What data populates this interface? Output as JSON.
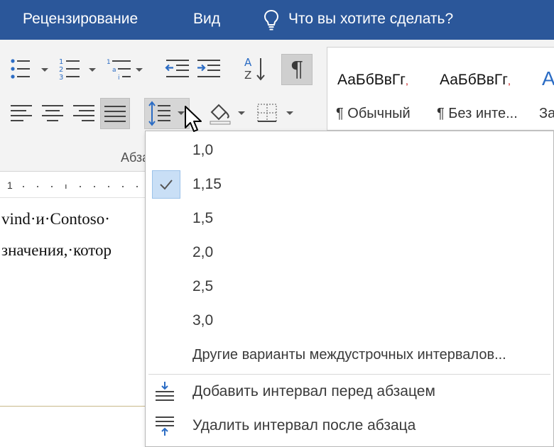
{
  "tabs": [
    {
      "label": "Рецензирование"
    },
    {
      "label": "Вид"
    }
  ],
  "tell_me": {
    "label": "Что вы хотите сделать?",
    "icon": "lightbulb-icon"
  },
  "ribbon": {
    "group_label": "Абзац",
    "pilcrow": "¶",
    "styles": [
      {
        "sample": "АаБбВвГг",
        "sample_tail": ",",
        "name": "¶ Обычный"
      },
      {
        "sample": "АаБбВвГг",
        "sample_tail": ",",
        "name": "¶ Без инте..."
      },
      {
        "sample": "А",
        "sample_tail": "",
        "name": "За"
      }
    ]
  },
  "document": {
    "ruler_number": "1",
    "lines": [
      "vind·и·Contoso·",
      "значения,·котор"
    ]
  },
  "menu": {
    "spacing_options": [
      {
        "label": "1,0",
        "checked": false
      },
      {
        "label": "1,15",
        "checked": true
      },
      {
        "label": "1,5",
        "checked": false
      },
      {
        "label": "2,0",
        "checked": false
      },
      {
        "label": "2,5",
        "checked": false
      },
      {
        "label": "3,0",
        "checked": false
      }
    ],
    "more_options": "Другие варианты междустрочных интервалов...",
    "add_before": "Добавить интервал перед абзацем",
    "remove_after": "Удалить интервал после абзаца"
  },
  "colors": {
    "title_bar": "#2b579a",
    "icon_blue": "#2b6cc4",
    "checked_bg": "#c9dff6",
    "style_accent": "#c00000"
  }
}
